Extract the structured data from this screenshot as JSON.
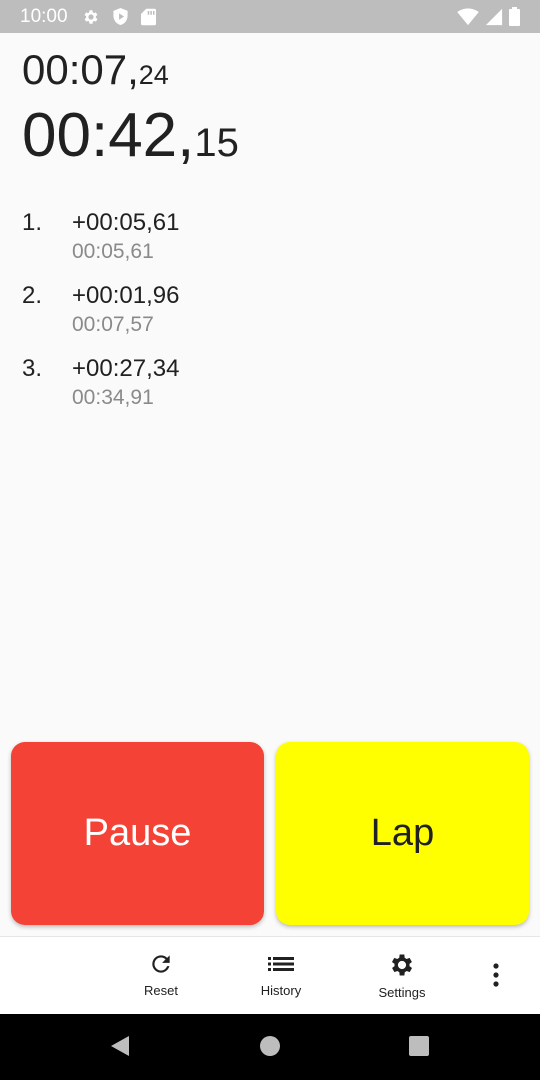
{
  "status_bar": {
    "time": "10:00",
    "left_icons": [
      "gear-icon",
      "shield-icon",
      "sd-card-icon"
    ],
    "right_icons": [
      "wifi-icon",
      "signal-icon",
      "battery-icon"
    ]
  },
  "timer": {
    "lap_main": "00:07,",
    "lap_hundredths": "24",
    "total_main": "00:42,",
    "total_hundredths": "15"
  },
  "laps": [
    {
      "number": "1.",
      "diff": "+00:05,61",
      "total": "00:05,61"
    },
    {
      "number": "2.",
      "diff": "+00:01,96",
      "total": "00:07,57"
    },
    {
      "number": "3.",
      "diff": "+00:27,34",
      "total": "00:34,91"
    }
  ],
  "buttons": {
    "pause_label": "Pause",
    "lap_label": "Lap"
  },
  "bottom_bar": {
    "reset_label": "Reset",
    "history_label": "History",
    "settings_label": "Settings"
  },
  "colors": {
    "pause": "#f44336",
    "lap": "#ffff00",
    "status_bar": "#bdbdbd",
    "secondary_text": "#8a8a8a"
  }
}
